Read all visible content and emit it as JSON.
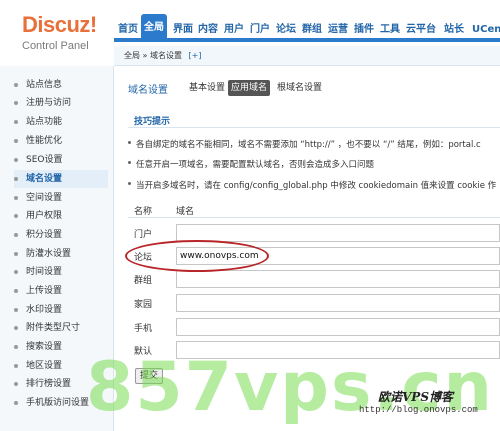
{
  "logo": {
    "brand": "Discuz!",
    "subtitle": "Control Panel"
  },
  "topnav": {
    "tabs": [
      "首页",
      "全局",
      "界面",
      "内容",
      "用户",
      "门户",
      "论坛",
      "群组",
      "运营",
      "插件",
      "工具",
      "云平台",
      "站长",
      "UCen"
    ]
  },
  "breadcrumb": {
    "text": "全局 » 域名设置",
    "add": "[+]"
  },
  "sidebar": {
    "items": [
      "站点信息",
      "注册与访问",
      "站点功能",
      "性能优化",
      "SEO设置",
      "域名设置",
      "空间设置",
      "用户权限",
      "积分设置",
      "防灌水设置",
      "时间设置",
      "上传设置",
      "水印设置",
      "附件类型尺寸",
      "搜索设置",
      "地区设置",
      "排行榜设置",
      "手机版访问设置"
    ]
  },
  "main": {
    "title": "域名设置",
    "subtabs": [
      "基本设置",
      "应用域名",
      "根域名设置"
    ],
    "tips_heading": "技巧提示",
    "tips": [
      "各自绑定的域名不能相同，域名不需要添加 “http://” ，也不要以 “/” 结尾，例如：portal.c",
      "任意开启一项域名，需要配置默认域名，否则会造成多入口问题",
      "当开启多域名时，请在 config/config_global.php 中修改 cookiedomain 值来设置 cookie 作"
    ],
    "col_name": "名称",
    "col_domain": "域名",
    "rows": [
      {
        "label": "门户",
        "value": ""
      },
      {
        "label": "论坛",
        "value": "www.onovps.com"
      },
      {
        "label": "群组",
        "value": ""
      },
      {
        "label": "家园",
        "value": ""
      },
      {
        "label": "手机",
        "value": ""
      },
      {
        "label": "默认",
        "value": ""
      }
    ],
    "submit": "提交"
  },
  "watermark": {
    "big": "857vps.cn",
    "blog_name": "欧诺VPS博客",
    "blog_url": "http://blog.onovps.com"
  },
  "colors": {
    "accent": "#2b7acb",
    "highlight_oval": "#b8262a",
    "watermark": "#78dc50"
  }
}
